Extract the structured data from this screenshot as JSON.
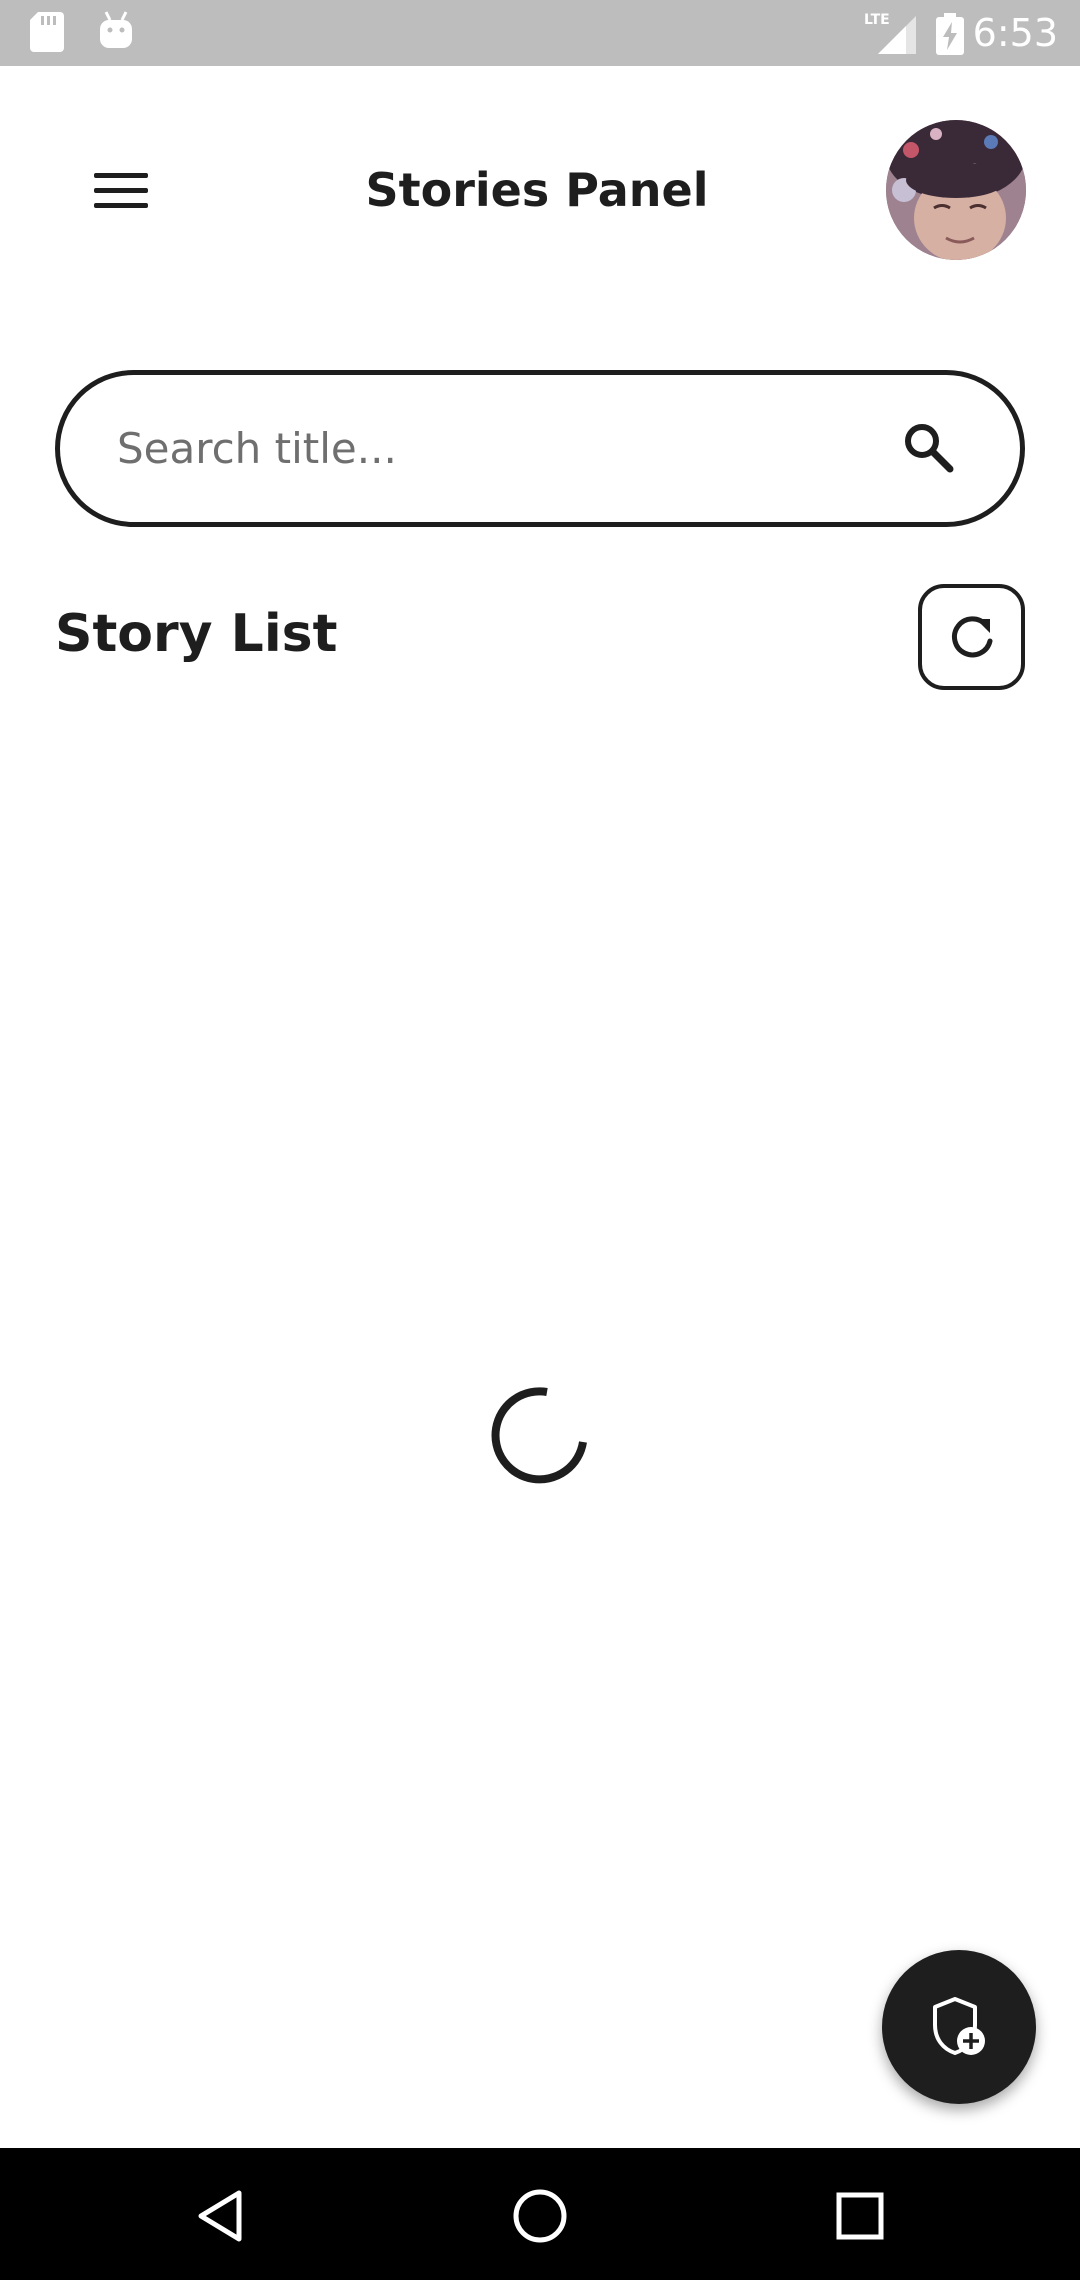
{
  "status_bar": {
    "time": "6:53",
    "network": "LTE",
    "icons": [
      "sd-card-icon",
      "android-icon",
      "lte-signal-icon",
      "battery-charging-icon"
    ]
  },
  "header": {
    "title": "Stories Panel",
    "menu_icon": "hamburger-menu-icon",
    "avatar_icon": "user-avatar"
  },
  "search": {
    "placeholder": "Search title...",
    "value": "",
    "icon": "search-icon"
  },
  "story_list": {
    "title": "Story List",
    "refresh_icon": "refresh-icon",
    "loading": true
  },
  "fab": {
    "icon": "shield-plus-icon"
  },
  "nav_bar": {
    "buttons": [
      "back-icon",
      "home-icon",
      "recents-icon"
    ]
  },
  "colors": {
    "text": "#1e1e1e",
    "status_bar": "#bdbdbd",
    "nav_bar": "#000000",
    "fab": "#1e1e1e",
    "background": "#ffffff"
  }
}
